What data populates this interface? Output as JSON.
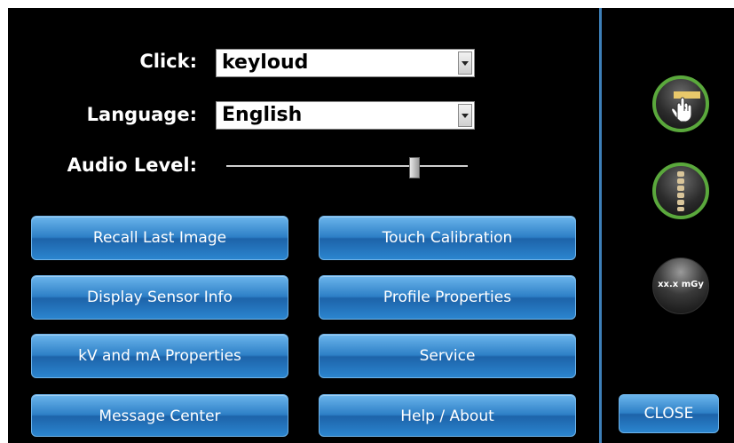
{
  "settings": {
    "click_label": "Click:",
    "click_value": "keyloud",
    "language_label": "Language:",
    "language_value": "English",
    "audio_label": "Audio Level:",
    "audio_level": 0.78
  },
  "buttons": {
    "recall_last_image": "Recall Last Image",
    "touch_calibration": "Touch Calibration",
    "display_sensor_info": "Display Sensor Info",
    "profile_properties": "Profile Properties",
    "kv_ma_properties": "kV and mA Properties",
    "service": "Service",
    "message_center": "Message Center",
    "help_about": "Help / About",
    "close": "CLOSE"
  },
  "side_icons": {
    "touch_icon": "hand-pointer-icon",
    "spine_icon": "spine-icon",
    "dose_label": "xx.x mGy"
  },
  "colors": {
    "background": "#000000",
    "divider": "#3d7fb8",
    "button_blue": "#2d7fc6",
    "ring_green": "#5aa83c"
  }
}
